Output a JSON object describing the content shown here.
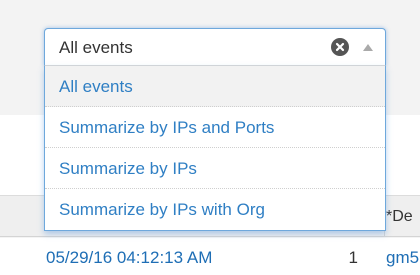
{
  "select": {
    "value": "All events",
    "options": [
      "All events",
      "Summarize by IPs and Ports",
      "Summarize by IPs",
      "Summarize by IPs with Org"
    ]
  },
  "table": {
    "header_partial": "*De",
    "row": {
      "time": "05/29/16 04:12:13 AM",
      "count": "1",
      "host": "gm5"
    }
  },
  "colors": {
    "accent": "#2f7fc4",
    "focus_border": "#6ea8dc"
  },
  "icons": {
    "clear": "clear-circle-x-icon",
    "toggle": "caret-up-icon"
  }
}
